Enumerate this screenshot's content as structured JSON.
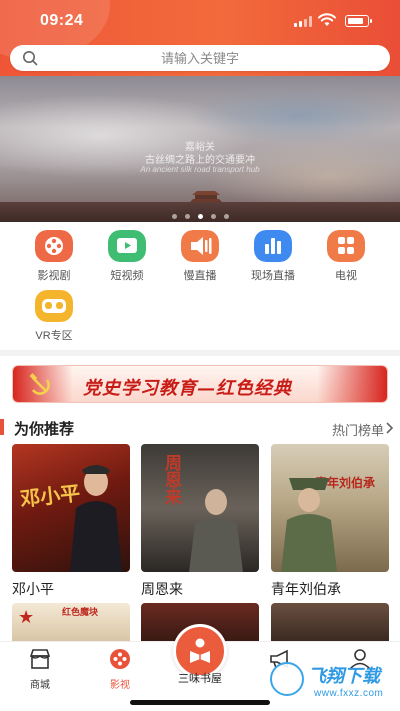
{
  "status_bar": {
    "time": "09:24"
  },
  "search": {
    "placeholder": "请输入关键字"
  },
  "banner": {
    "line1": "嘉峪关",
    "line2": "古丝绸之路上的交通要冲",
    "line3": "An ancient silk road transport hub",
    "dots": 5,
    "active_dot": 2
  },
  "categories": [
    {
      "label": "影视剧",
      "icon": "film-reel-icon",
      "color": "#ee6a46"
    },
    {
      "label": "短视频",
      "icon": "play-icon",
      "color": "#3fbd72"
    },
    {
      "label": "慢直播",
      "icon": "broadcast-icon",
      "color": "#f07b49"
    },
    {
      "label": "现场直播",
      "icon": "bar-chart-icon",
      "color": "#3f8af0"
    },
    {
      "label": "电视",
      "icon": "tv-grid-icon",
      "color": "#f07b49"
    },
    {
      "label": "VR专区",
      "icon": "vr-goggles-icon",
      "color": "#f4b52c"
    }
  ],
  "slogan": {
    "text": "党史学习教育—红色经典"
  },
  "recommend": {
    "title": "为你推荐",
    "more": "热门榜单",
    "items": [
      {
        "title": "邓小平",
        "poster_text": "邓小平"
      },
      {
        "title": "周恩来",
        "poster_text": "周恩来"
      },
      {
        "title": "青年刘伯承",
        "poster_text": "青年刘伯承"
      }
    ],
    "row2_text": "红色魔块"
  },
  "nav": {
    "items": [
      {
        "label": "商城",
        "icon": "store-icon",
        "active": false
      },
      {
        "label": "影视",
        "icon": "film-reel-icon",
        "active": true
      },
      {
        "label": "三味书屋",
        "icon": "book-reader-icon",
        "active": false
      },
      {
        "label": "",
        "icon": "megaphone-icon",
        "active": false
      },
      {
        "label": "",
        "icon": "user-icon",
        "active": false
      }
    ]
  },
  "watermark": {
    "title": "飞翔下载",
    "url": "www.fxxz.com"
  },
  "colors": {
    "accent": "#e8523a",
    "header": "#ef5637"
  }
}
